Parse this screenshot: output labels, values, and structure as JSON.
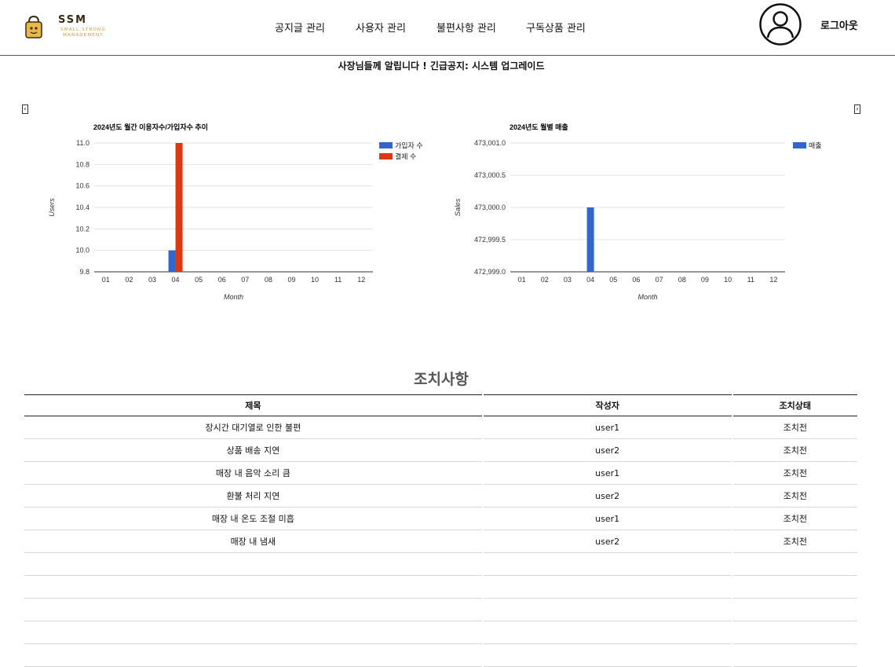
{
  "header": {
    "logo": {
      "name": "SSM",
      "sub": "SMALL STRONG MANAGEMENT"
    },
    "nav": [
      {
        "label": "공지글 관리"
      },
      {
        "label": "사용자 관리"
      },
      {
        "label": "불편사항 관리"
      },
      {
        "label": "구독상품 관리"
      }
    ],
    "logout_label": "로그아웃"
  },
  "notice": "사장님들께 알립니다 ! 긴급공지: 시스템 업그레이드",
  "carousel": {
    "prev": "‹",
    "next": "›"
  },
  "chart_data": [
    {
      "type": "bar",
      "title": "2024년도 월간 이용자수/가입자수 추이",
      "xlabel": "Month",
      "ylabel": "Users",
      "categories": [
        "01",
        "02",
        "03",
        "04",
        "05",
        "06",
        "07",
        "08",
        "09",
        "10",
        "11",
        "12"
      ],
      "ylim": [
        9.8,
        11.0
      ],
      "yticks": [
        "11.0",
        "10.8",
        "10.6",
        "10.4",
        "10.2",
        "10.0",
        "9.8"
      ],
      "series": [
        {
          "name": "가입자 수",
          "color": "#3366cc",
          "values": [
            null,
            null,
            null,
            10,
            null,
            null,
            null,
            null,
            null,
            null,
            null,
            null
          ]
        },
        {
          "name": "결제 수",
          "color": "#dc3912",
          "values": [
            null,
            null,
            null,
            11,
            null,
            null,
            null,
            null,
            null,
            null,
            null,
            null
          ]
        }
      ],
      "legend": "right",
      "grid": true
    },
    {
      "type": "bar",
      "title": "2024년도 월별 매출",
      "xlabel": "Month",
      "ylabel": "Sales",
      "categories": [
        "01",
        "02",
        "03",
        "04",
        "05",
        "06",
        "07",
        "08",
        "09",
        "10",
        "11",
        "12"
      ],
      "ylim": [
        472999.0,
        473001.0
      ],
      "yticks": [
        "473,001.0",
        "473,000.5",
        "473,000.0",
        "472,999.5",
        "472,999.0"
      ],
      "series": [
        {
          "name": "매출",
          "color": "#3366cc",
          "values": [
            null,
            null,
            null,
            473000,
            null,
            null,
            null,
            null,
            null,
            null,
            null,
            null
          ]
        }
      ],
      "legend": "right",
      "grid": true
    }
  ],
  "issues": {
    "title": "조치사항",
    "columns": [
      "제목",
      "작성자",
      "조치상태"
    ],
    "rows": [
      [
        "장시간 대기열로 인한 불편",
        "user1",
        "조치전"
      ],
      [
        "상품 배송 지연",
        "user2",
        "조치전"
      ],
      [
        "매장 내 음악 소리 큼",
        "user1",
        "조치전"
      ],
      [
        "환불 처리 지연",
        "user2",
        "조치전"
      ],
      [
        "매장 내 온도 조절 미흡",
        "user1",
        "조치전"
      ],
      [
        "매장 내 냄새",
        "user2",
        "조치전"
      ]
    ]
  }
}
